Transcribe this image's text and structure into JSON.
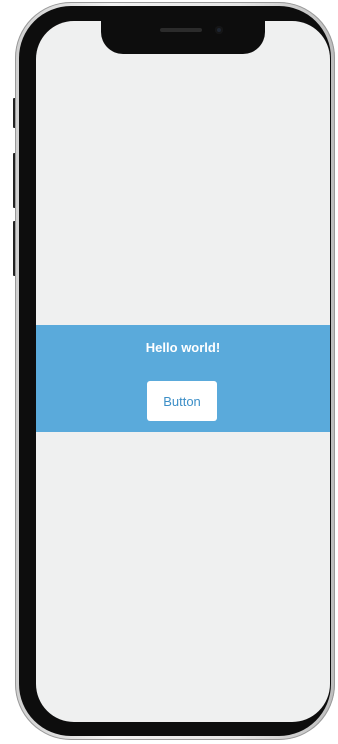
{
  "banner": {
    "title": "Hello world!",
    "button_label": "Button"
  },
  "colors": {
    "banner_bg": "#5aaadb",
    "screen_bg": "#eff0f0",
    "button_text": "#3d8fc7"
  }
}
